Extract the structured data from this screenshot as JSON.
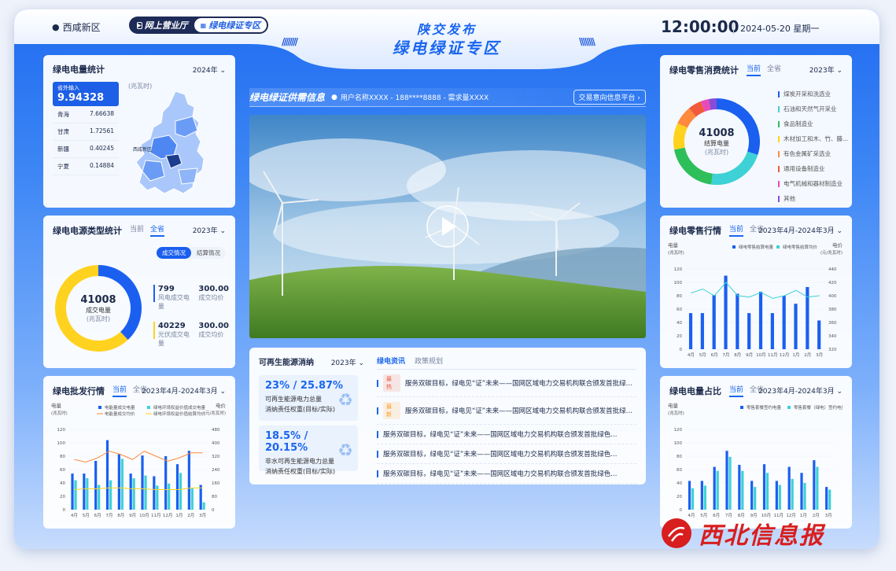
{
  "header": {
    "location": "西咸新区",
    "nav": [
      "网上营业厅",
      "绿电绿证专区"
    ],
    "title_small": "陕交发布",
    "title_main": "绿电绿证专区",
    "time": "12:00:00",
    "date": "2024-05-20  星期一"
  },
  "generation": {
    "title": "绿电电量统计",
    "year": "2024年",
    "unit": "(兆瓦时)",
    "inbound_label": "省外输入",
    "inbound_value": "9.94328",
    "provinces": [
      {
        "name": "青海",
        "value": "7.66638"
      },
      {
        "name": "甘肃",
        "value": "1.72561"
      },
      {
        "name": "新疆",
        "value": "0.40245"
      },
      {
        "name": "宁夏",
        "value": "0.14884"
      }
    ],
    "map_city": "西咸新区"
  },
  "source_type": {
    "title": "绿电电源类型统计",
    "tabs": [
      "当前",
      "全省"
    ],
    "year": "2023年",
    "toggle": [
      "成交情况",
      "结算情况"
    ],
    "center_value": "41008",
    "center_label": "成交电量",
    "center_unit": "(兆瓦时)",
    "items": [
      {
        "value": "799",
        "label": "风电成交电量",
        "price": "300.00",
        "price_label": "成交均价",
        "color": "#1a5ff0",
        "share": 0.38
      },
      {
        "value": "40229",
        "label": "光伏成交电量",
        "price": "300.00",
        "price_label": "成交均价",
        "color": "#ffd21f",
        "share": 0.62
      }
    ]
  },
  "wholesale": {
    "title": "绿电批发行情",
    "tabs": [
      "当前",
      "全省"
    ],
    "period": "2023年4月-2024年3月",
    "ylabel": "电量",
    "yunit": "(兆瓦时)",
    "y2label": "电价",
    "y2unit": "(元/兆瓦时)",
    "legend": [
      "电能量成交电量",
      "绿电环境权益价值成交电量",
      "电能量成交均价",
      "绿电环境权益价值结算均价"
    ],
    "chart_data": {
      "type": "bar",
      "categories": [
        "4月",
        "5月",
        "6月",
        "7月",
        "8月",
        "9月",
        "10月",
        "11月",
        "12月",
        "1月",
        "2月",
        "3月"
      ],
      "series": [
        {
          "name": "电能量成交电量",
          "values": [
            54,
            54,
            73,
            104,
            83,
            54,
            81,
            50,
            80,
            68,
            88,
            37
          ],
          "color": "#1a5ff0"
        },
        {
          "name": "绿电环境权益价值成交电量",
          "values": [
            44,
            47,
            37,
            44,
            76,
            47,
            51,
            36,
            39,
            55,
            32,
            11
          ],
          "color": "#3ed1d6"
        },
        {
          "name": "电能量成交均价",
          "values": [
            300,
            285,
            310,
            350,
            330,
            300,
            350,
            320,
            290,
            310,
            340,
            340
          ],
          "color": "#ff8a3d"
        },
        {
          "name": "绿电环境权益价值结算均价",
          "values": [
            120,
            125,
            125,
            130,
            130,
            125,
            125,
            120,
            120,
            120,
            130,
            130
          ],
          "color": "#ffd21f"
        }
      ],
      "ylim": [
        0,
        120
      ],
      "y2lim": [
        0,
        480
      ],
      "yticks": [
        0,
        20,
        40,
        60,
        80,
        100,
        120
      ],
      "y2ticks": [
        0,
        80,
        160,
        240,
        320,
        400,
        480
      ]
    }
  },
  "supply": {
    "title": "绿电绿证供需信息",
    "info": "用户名称XXXX  -  188****8888  -  需求量XXXX",
    "link": "交易意向信息平台 ›"
  },
  "renewable": {
    "title": "可再生能源消纳",
    "year": "2023年",
    "items": [
      {
        "value": "23% / 25.87%",
        "desc1": "可再生能源电力总量",
        "desc2": "消纳责任权重(目标/实际)"
      },
      {
        "value": "18.5% / 20.15%",
        "desc1": "非水可再生能源电力总量",
        "desc2": "消纳责任权重(目标/实际)"
      }
    ]
  },
  "news": {
    "tabs": [
      "绿电资讯",
      "政策规划"
    ],
    "items": [
      {
        "tag": "最热",
        "tag_color": "#f05a3a",
        "text": "服务双碳目标，绿电见“证”未来——国网区域电力交易机构联合颁发首批绿色..."
      },
      {
        "tag": "最新",
        "tag_color": "#ff9a1f",
        "text": "服务双碳目标，绿电见“证”未来——国网区域电力交易机构联合颁发首批绿色..."
      },
      {
        "tag": "",
        "tag_color": "",
        "text": "服务双碳目标，绿电见“证”未来——国网区域电力交易机构联合颁发首批绿色..."
      },
      {
        "tag": "",
        "tag_color": "",
        "text": "服务双碳目标，绿电见“证”未来——国网区域电力交易机构联合颁发首批绿色..."
      },
      {
        "tag": "",
        "tag_color": "",
        "text": "服务双碳目标，绿电见“证”未来——国网区域电力交易机构联合颁发首批绿色..."
      }
    ]
  },
  "retail_consume": {
    "title": "绿电零售消费统计",
    "tabs": [
      "当前",
      "全省"
    ],
    "year": "2023年",
    "center_value": "41008",
    "center_label": "结算电量",
    "center_unit": "(兆瓦时)",
    "items": [
      {
        "name": "煤炭开采和洗选业",
        "color": "#1a5ff0",
        "share": 0.3
      },
      {
        "name": "石油和天然气开采业",
        "color": "#3ed1d6",
        "share": 0.22
      },
      {
        "name": "食品制造业",
        "color": "#2fbf5a",
        "share": 0.2
      },
      {
        "name": "木材加工和木、竹、藤...",
        "color": "#ffd21f",
        "share": 0.1
      },
      {
        "name": "有色金属矿采选业",
        "color": "#ff8a3d",
        "share": 0.07
      },
      {
        "name": "通用设备制造业",
        "color": "#f05a3a",
        "share": 0.05
      },
      {
        "name": "电气机械和器材制造业",
        "color": "#e84bb8",
        "share": 0.03
      },
      {
        "name": "其他",
        "color": "#8a4bd8",
        "share": 0.03
      }
    ]
  },
  "retail_market": {
    "title": "绿电零售行情",
    "tabs": [
      "当前",
      "全省"
    ],
    "period": "2023年4月-2024年3月",
    "ylabel": "电量",
    "yunit": "(兆瓦时)",
    "y2label": "电价",
    "y2unit": "(元/兆瓦时)",
    "legend": [
      "绿电零售结算电量",
      "绿电零售结算均价"
    ],
    "chart_data": {
      "type": "bar",
      "categories": [
        "4月",
        "5月",
        "6月",
        "7月",
        "8月",
        "9月",
        "10月",
        "11月",
        "12月",
        "1月",
        "2月",
        "3月"
      ],
      "series": [
        {
          "name": "绿电零售结算电量",
          "values": [
            54,
            54,
            81,
            110,
            83,
            54,
            86,
            54,
            80,
            68,
            93,
            43
          ],
          "color": "#1a5ff0"
        },
        {
          "name": "绿电零售结算均价",
          "values": [
            404,
            410,
            400,
            420,
            400,
            398,
            405,
            396,
            400,
            408,
            398,
            400
          ],
          "color": "#3ed1d6"
        }
      ],
      "ylim": [
        0,
        120
      ],
      "y2lim": [
        320,
        440
      ],
      "yticks": [
        0,
        20,
        40,
        60,
        80,
        100,
        120
      ],
      "y2ticks": [
        320,
        340,
        360,
        380,
        400,
        420,
        440
      ]
    }
  },
  "share": {
    "title": "绿电电量占比",
    "tabs": [
      "当前",
      "全省"
    ],
    "period": "2023年4月-2024年3月",
    "ylabel": "电量",
    "yunit": "(兆瓦时)",
    "legend": [
      "零售套餐签约电量",
      "零售套餐（绿电）签约电量"
    ],
    "chart_data": {
      "type": "bar",
      "categories": [
        "4月",
        "5月",
        "6月",
        "7月",
        "8月",
        "9月",
        "10月",
        "11月",
        "12月",
        "1月",
        "2月",
        "3月"
      ],
      "series": [
        {
          "name": "零售套餐签约电量",
          "values": [
            43,
            43,
            64,
            88,
            67,
            43,
            68,
            43,
            64,
            55,
            74,
            34
          ],
          "color": "#1a5ff0"
        },
        {
          "name": "零售套餐（绿电）签约电量",
          "values": [
            32,
            36,
            58,
            79,
            58,
            34,
            55,
            37,
            46,
            40,
            64,
            30
          ],
          "color": "#3ed1d6"
        }
      ],
      "ylim": [
        0,
        120
      ],
      "yticks": [
        0,
        20,
        40,
        60,
        80,
        100,
        120
      ]
    }
  },
  "watermark": "西北信息报"
}
